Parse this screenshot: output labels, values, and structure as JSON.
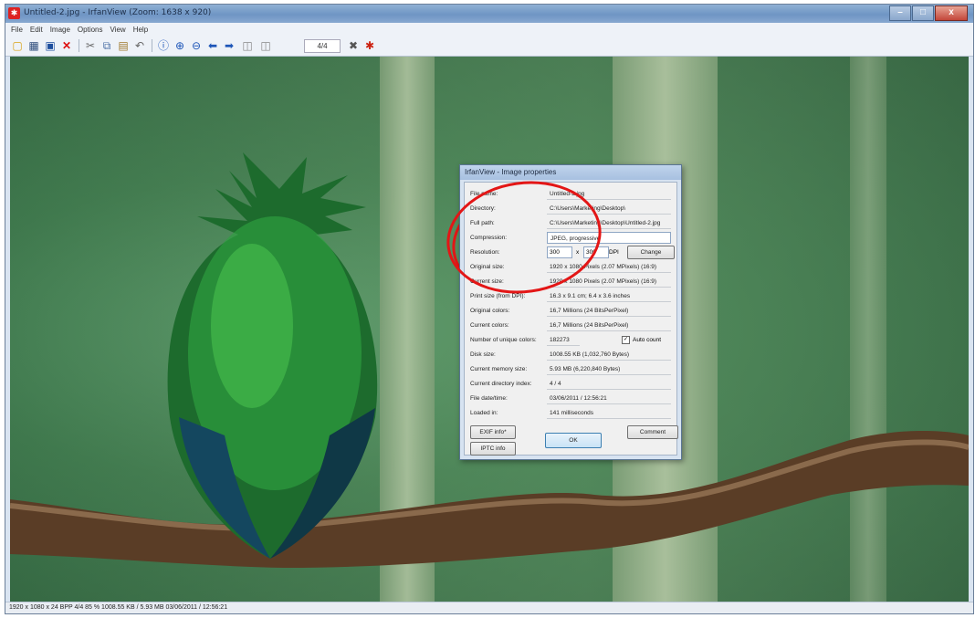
{
  "window": {
    "title": "Untitled-2.jpg - IrfanView (Zoom: 1638 x 920)",
    "controls": {
      "minimize": "–",
      "maximize": "□",
      "close": "x"
    }
  },
  "menu": [
    "File",
    "Edit",
    "Image",
    "Options",
    "View",
    "Help"
  ],
  "toolbar": {
    "icons": [
      "open-folder-icon",
      "slideshow-icon",
      "save-icon",
      "delete-icon",
      "cut-icon",
      "copy-icon",
      "paste-icon",
      "undo-icon",
      "info-icon",
      "zoom-in-icon",
      "zoom-out-icon",
      "previous-icon",
      "next-icon",
      "first-page-icon",
      "last-page-icon",
      "settings-icon",
      "exit-icon"
    ],
    "page_counter": "4/4"
  },
  "dialog": {
    "title": "IrfanView - Image properties",
    "rows": [
      {
        "label": "File name:",
        "value": "Untitled-2.jpg"
      },
      {
        "label": "Directory:",
        "value": "C:\\Users\\Marketing\\Desktop\\"
      },
      {
        "label": "Full path:",
        "value": "C:\\Users\\Marketing\\Desktop\\Untitled-2.jpg"
      },
      {
        "label": "Compression:",
        "value": "JPEG, progressive"
      },
      {
        "label": "Resolution:",
        "value": ""
      },
      {
        "label": "Original size:",
        "value": "1920 x 1080  Pixels (2.07 MPixels) (16:9)"
      },
      {
        "label": "Current size:",
        "value": "1920 x 1080  Pixels (2.07 MPixels) (16:9)"
      },
      {
        "label": "Print size (from DPI):",
        "value": "16.3 x 9.1 cm; 6.4 x 3.6 inches"
      },
      {
        "label": "Original colors:",
        "value": "16,7 Millions  (24 BitsPerPixel)"
      },
      {
        "label": "Current colors:",
        "value": "16,7 Millions  (24 BitsPerPixel)"
      },
      {
        "label": "Number of unique colors:",
        "value": "182273"
      },
      {
        "label": "Disk size:",
        "value": "1008.55 KB (1,032,760 Bytes)"
      },
      {
        "label": "Current memory size:",
        "value": "5.93  MB (6,220,840 Bytes)"
      },
      {
        "label": "Current directory index:",
        "value": "4  /  4"
      },
      {
        "label": "File date/time:",
        "value": "03/06/2011 / 12:56:21"
      },
      {
        "label": "Loaded in:",
        "value": "141 milliseconds"
      }
    ],
    "resolution": {
      "x": "300",
      "sep": "x",
      "y": "300",
      "unit": "DPI",
      "change_label": "Change"
    },
    "auto_count_label": "Auto count",
    "auto_count_checked": true,
    "buttons": {
      "exif": "EXIF info*",
      "iptc": "IPTC info",
      "ok": "OK",
      "comment": "Comment"
    }
  },
  "status": {
    "text": "1920 x 1080 x 24 BPP   4/4   85 %   1008.55 KB / 5.93 MB   03/06/2011 / 12:56:21"
  },
  "colors": {
    "annotation_circle": "#e31616",
    "titlebar": "#7fa3ce"
  }
}
